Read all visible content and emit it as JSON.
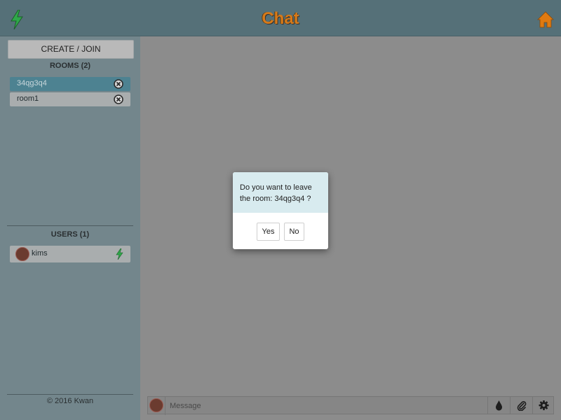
{
  "header": {
    "title": "Chat",
    "logo_icon": "lightning-bolt-icon",
    "home_icon": "home-icon",
    "colors": {
      "bar": "#557078",
      "title": "#d77a1a",
      "home": "#e07a10",
      "bolt": "#2fa84a"
    }
  },
  "sidebar": {
    "create_join_label": "CREATE / JOIN",
    "rooms_title": "ROOMS (2)",
    "rooms": [
      {
        "label": "34qg3q4",
        "active": true
      },
      {
        "label": "room1",
        "active": false
      }
    ],
    "users_title": "USERS (1)",
    "users": [
      {
        "name": "kims",
        "status_icon": "lightning-bolt-icon"
      }
    ],
    "footer": "© 2016 Kwan"
  },
  "composer": {
    "placeholder": "Message",
    "tools": [
      "drop-icon",
      "paperclip-icon",
      "gear-icon"
    ]
  },
  "dialog": {
    "message": "Do you want to leave the room: 34qg3q4 ?",
    "yes_label": "Yes",
    "no_label": "No"
  }
}
